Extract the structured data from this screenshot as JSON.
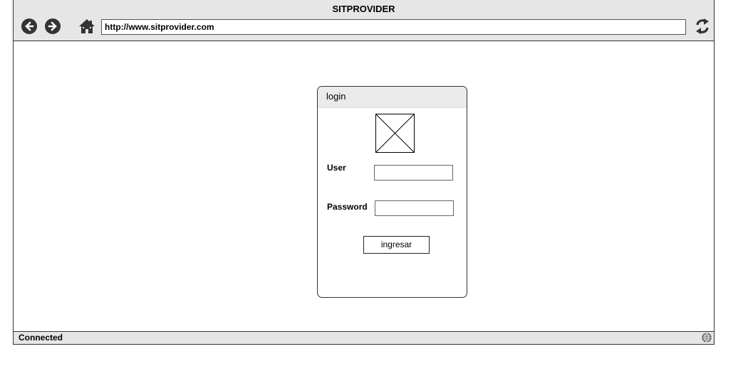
{
  "window": {
    "title": "SITPROVIDER"
  },
  "toolbar": {
    "back_icon": "arrow-left-circle",
    "forward_icon": "arrow-right-circle",
    "home_icon": "home",
    "refresh_icon": "refresh",
    "url": "http://www.sitprovider.com"
  },
  "login": {
    "title": "login",
    "image_placeholder": "image",
    "user_label": "User",
    "user_value": "",
    "password_label": "Password",
    "password_value": "",
    "submit_label": "ingresar"
  },
  "status_bar": {
    "text": "Connected",
    "icon": "globe"
  },
  "colors": {
    "chrome": "#e6e6e6",
    "border": "#333333",
    "header": "#ebebeb"
  }
}
